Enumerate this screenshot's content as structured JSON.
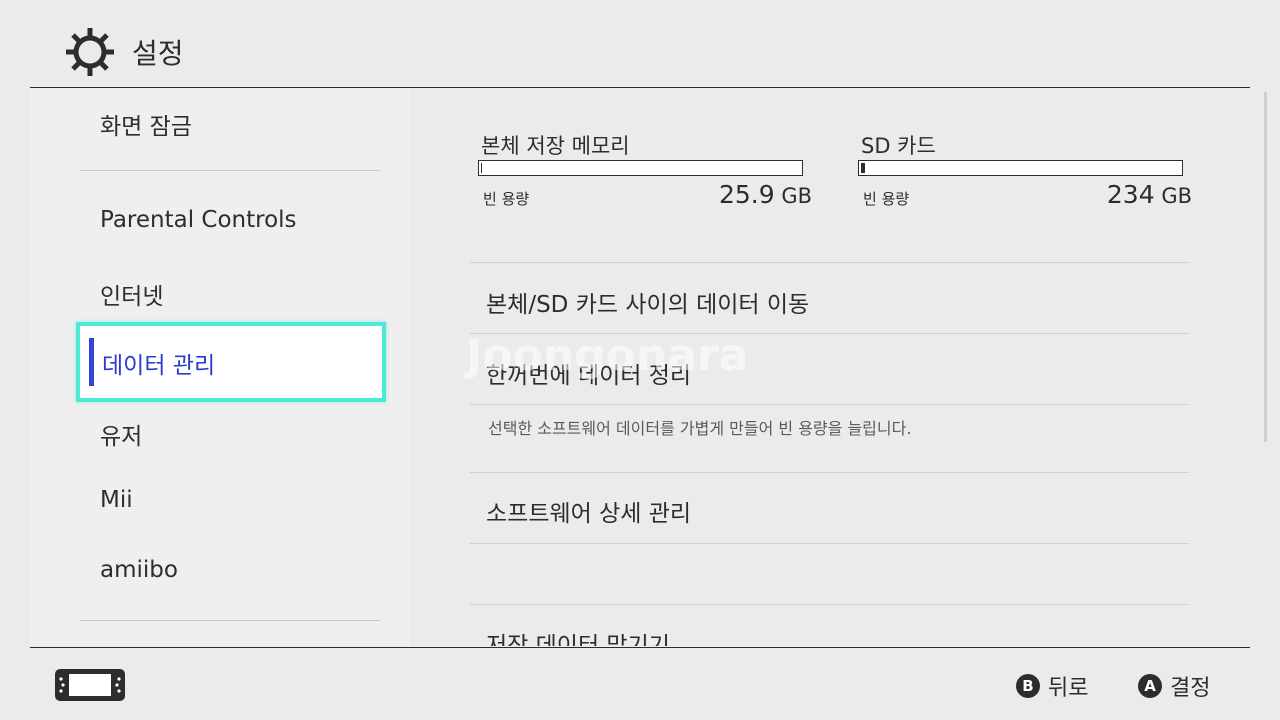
{
  "header": {
    "title": "설정",
    "icon": "gear-icon"
  },
  "sidebar": {
    "items": [
      {
        "label": "화면 잠금"
      },
      {
        "label": "Parental Controls"
      },
      {
        "label": "인터넷"
      },
      {
        "label": "데이터 관리",
        "selected": true
      },
      {
        "label": "유저"
      },
      {
        "label": "Mii"
      },
      {
        "label": "amiibo"
      }
    ]
  },
  "storage": {
    "system": {
      "name": "본체 저장 메모리",
      "free_label": "빈 용량",
      "free_value": "25.9",
      "unit": "GB"
    },
    "sd": {
      "name": "SD 카드",
      "free_label": "빈 용량",
      "free_value": "234",
      "unit": "GB"
    }
  },
  "menu": {
    "move_data": "본체/SD 카드 사이의 데이터 이동",
    "quick_archive": "한꺼번에 데이터 정리",
    "quick_archive_desc": "선택한 소프트웨어 데이터를 가볍게 만들어 빈 용량을 늘립니다.",
    "manage_software": "소프트웨어 상세 관리",
    "save_data": "저장 데이터 맡기기"
  },
  "watermark": "Joongonara",
  "footer": {
    "back": {
      "button": "B",
      "label": "뒤로"
    },
    "ok": {
      "button": "A",
      "label": "결정"
    }
  },
  "colors": {
    "accent": "#2b3bd0",
    "focus": "#4ee8d6",
    "background": "#ebebeb"
  }
}
